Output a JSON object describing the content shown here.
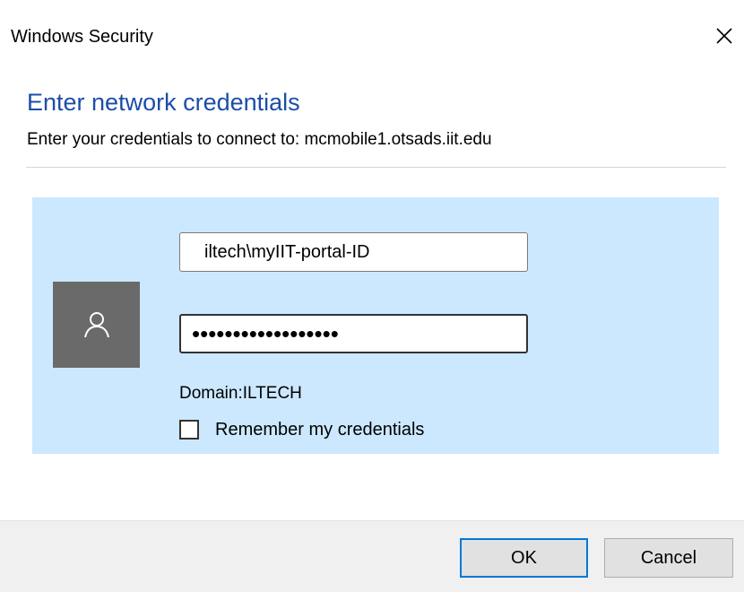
{
  "window": {
    "title": "Windows Security",
    "close_icon": "close-icon"
  },
  "header": {
    "heading": "Enter network credentials",
    "subheading": "Enter your credentials to connect to: mcmobile1.otsads.iit.edu"
  },
  "credentials": {
    "avatar_icon": "user-icon",
    "username_value": "iltech\\myIIT-portal-ID",
    "password_value": "••••••••••••••••••",
    "domain_label": "Domain:",
    "domain_value": "ILTECH",
    "remember_label": "Remember my credentials",
    "remember_checked": false
  },
  "buttons": {
    "ok_label": "OK",
    "cancel_label": "Cancel"
  },
  "colors": {
    "heading": "#1c4da8",
    "panel_background": "#cce8ff",
    "avatar_background": "#6a6a6a",
    "default_button_border": "#0078d7",
    "footer_background": "#f0f0f0"
  }
}
